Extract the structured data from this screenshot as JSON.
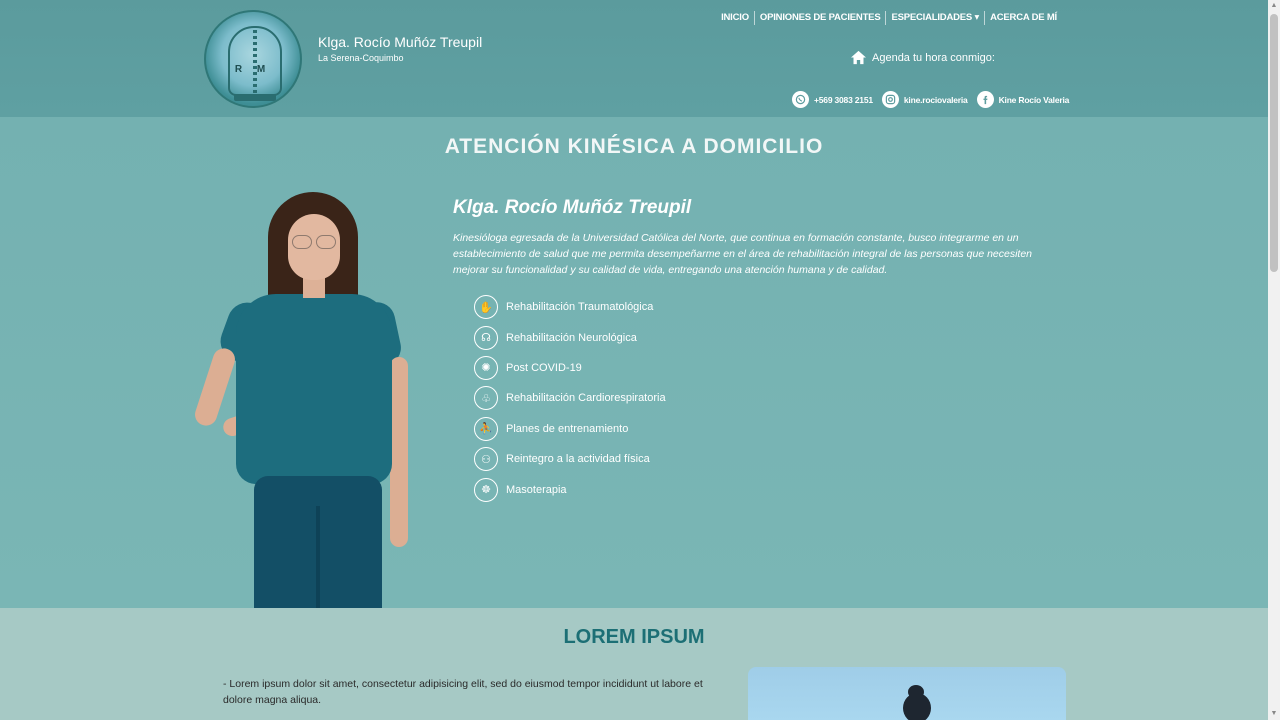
{
  "header": {
    "logo_letters": "R M",
    "brand_name": "Klga. Rocío Muñóz Treupil",
    "location": "La Serena-Coquimbo",
    "nav": [
      {
        "label": "INICIO"
      },
      {
        "label": "OPINIONES DE PACIENTES"
      },
      {
        "label": "ESPECIALIDADES ▾"
      },
      {
        "label": "ACERCA DE MÍ"
      }
    ],
    "agenda_text": "Agenda tu hora conmigo:",
    "contacts": {
      "whatsapp": "+569 3083 2151",
      "instagram": "kine.rociovaleria",
      "facebook": "Kine Rocío Valeria"
    }
  },
  "hero": {
    "title": "ATENCIÓN KINÉSICA A DOMICILIO",
    "name": "Klga. Rocío Muñóz Treupil",
    "description": "Kinesióloga egresada de la Universidad Católica del Norte, que continua en formación constante, busco integrarme en un establecimiento de salud que me permita desempeñarme en el área de rehabilitación integral de las personas que necesiten mejorar su funcionalidad y su calidad de vida, entregando una atención humana y de calidad.",
    "services": [
      {
        "label": "Rehabilitación Traumatológica",
        "icon": "joint-icon"
      },
      {
        "label": "Rehabilitación Neurológica",
        "icon": "brain-icon"
      },
      {
        "label": "Post COVID-19",
        "icon": "covid-icon"
      },
      {
        "label": "Rehabilitación Cardiorespiratoria",
        "icon": "lungs-icon"
      },
      {
        "label": "Planes de entrenamiento",
        "icon": "exercise-icon"
      },
      {
        "label": "Reintegro a la actividad física",
        "icon": "people-icon"
      },
      {
        "label": "Masoterapia",
        "icon": "massage-icon"
      }
    ]
  },
  "lower": {
    "title": "LOREM IPSUM",
    "text": "- Lorem ipsum dolor sit amet, consectetur adipisicing elit, sed do eiusmod tempor incididunt ut labore et dolore magna aliqua."
  }
}
